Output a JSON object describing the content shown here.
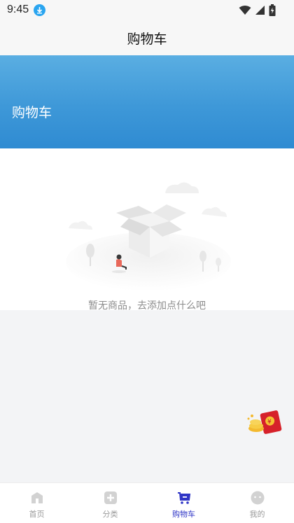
{
  "status_bar": {
    "time": "9:45"
  },
  "app_bar": {
    "title": "购物车"
  },
  "banner": {
    "title": "购物车"
  },
  "empty_state": {
    "message": "暂无商品，去添加点什么吧"
  },
  "tabs": [
    {
      "label": "首页",
      "icon": "home-icon",
      "active": false
    },
    {
      "label": "分类",
      "icon": "category-icon",
      "active": false
    },
    {
      "label": "购物车",
      "icon": "cart-icon",
      "active": true
    },
    {
      "label": "我的",
      "icon": "profile-icon",
      "active": false
    }
  ],
  "colors": {
    "banner": "#3e98d8",
    "active_tab": "#2f35c6",
    "inactive_tab": "#9a9a9a"
  }
}
